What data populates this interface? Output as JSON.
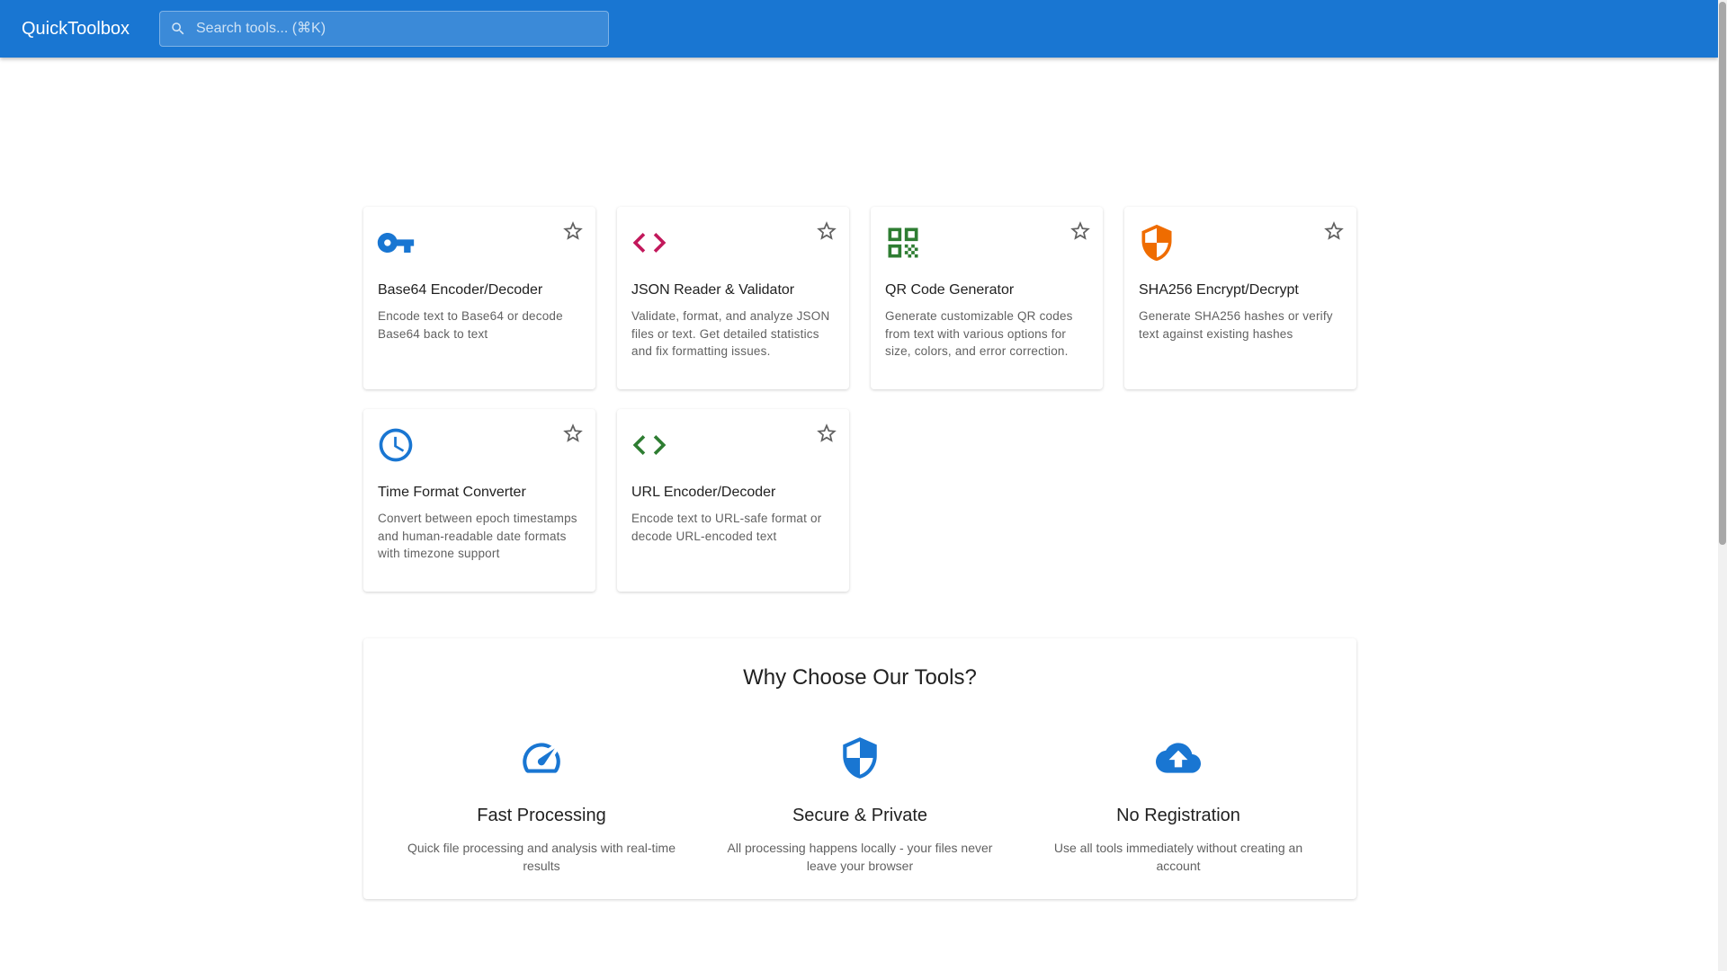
{
  "header": {
    "brand": "QuickToolbox",
    "search_placeholder": "Search tools... (⌘K)",
    "search_value": ""
  },
  "colors": {
    "appbar": "#1976d2",
    "base64_icon": "#1976d2",
    "json_icon": "#c2185b",
    "qr_icon": "#2e7d32",
    "sha_icon": "#ef6c00",
    "time_icon": "#1976d2",
    "url_icon": "#2e7d32"
  },
  "tools": [
    {
      "icon": "key-icon",
      "title": "Base64 Encoder/Decoder",
      "description": "Encode text to Base64 or decode Base64 back to text"
    },
    {
      "icon": "code-icon",
      "title": "JSON Reader & Validator",
      "description": "Validate, format, and analyze JSON files or text. Get detailed statistics and fix formatting issues."
    },
    {
      "icon": "qr-code-icon",
      "title": "QR Code Generator",
      "description": "Generate customizable QR codes from text with various options for size, colors, and error correction."
    },
    {
      "icon": "shield-icon",
      "title": "SHA256 Encrypt/Decrypt",
      "description": "Generate SHA256 hashes or verify text against existing hashes"
    },
    {
      "icon": "clock-icon",
      "title": "Time Format Converter",
      "description": "Convert between epoch timestamps and human-readable date formats with timezone support"
    },
    {
      "icon": "code-icon",
      "title": "URL Encoder/Decoder",
      "description": "Encode text to URL-safe format or decode URL-encoded text"
    }
  ],
  "why": {
    "title": "Why Choose Our Tools?",
    "features": [
      {
        "icon": "speedometer-icon",
        "title": "Fast Processing",
        "description": "Quick file processing and analysis with real-time results"
      },
      {
        "icon": "security-shield-icon",
        "title": "Secure & Private",
        "description": "All processing happens locally - your files never leave your browser"
      },
      {
        "icon": "cloud-upload-icon",
        "title": "No Registration",
        "description": "Use all tools immediately without creating an account"
      }
    ]
  }
}
